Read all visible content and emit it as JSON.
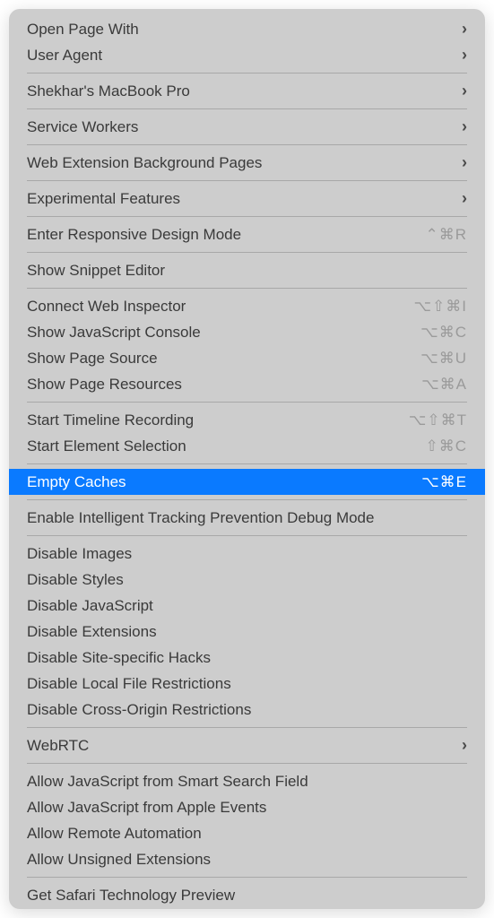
{
  "groups": [
    [
      {
        "id": "open-page-with",
        "label": "Open Page With",
        "submenu": true
      },
      {
        "id": "user-agent",
        "label": "User Agent",
        "submenu": true
      }
    ],
    [
      {
        "id": "device-name",
        "label": "Shekhar's MacBook Pro",
        "submenu": true
      }
    ],
    [
      {
        "id": "service-workers",
        "label": "Service Workers",
        "submenu": true
      }
    ],
    [
      {
        "id": "web-extension-bg-pages",
        "label": "Web Extension Background Pages",
        "submenu": true
      }
    ],
    [
      {
        "id": "experimental-features",
        "label": "Experimental Features",
        "submenu": true
      }
    ],
    [
      {
        "id": "enter-responsive-design",
        "label": "Enter Responsive Design Mode",
        "shortcut": "⌃⌘R"
      }
    ],
    [
      {
        "id": "show-snippet-editor",
        "label": "Show Snippet Editor"
      }
    ],
    [
      {
        "id": "connect-web-inspector",
        "label": "Connect Web Inspector",
        "shortcut": "⌥⇧⌘I"
      },
      {
        "id": "show-js-console",
        "label": "Show JavaScript Console",
        "shortcut": "⌥⌘C"
      },
      {
        "id": "show-page-source",
        "label": "Show Page Source",
        "shortcut": "⌥⌘U"
      },
      {
        "id": "show-page-resources",
        "label": "Show Page Resources",
        "shortcut": "⌥⌘A"
      }
    ],
    [
      {
        "id": "start-timeline-recording",
        "label": "Start Timeline Recording",
        "shortcut": "⌥⇧⌘T"
      },
      {
        "id": "start-element-selection",
        "label": "Start Element Selection",
        "shortcut": "⇧⌘C"
      }
    ],
    [
      {
        "id": "empty-caches",
        "label": "Empty Caches",
        "shortcut": "⌥⌘E",
        "highlighted": true
      }
    ],
    [
      {
        "id": "enable-itp-debug",
        "label": "Enable Intelligent Tracking Prevention Debug Mode"
      }
    ],
    [
      {
        "id": "disable-images",
        "label": "Disable Images"
      },
      {
        "id": "disable-styles",
        "label": "Disable Styles"
      },
      {
        "id": "disable-javascript",
        "label": "Disable JavaScript"
      },
      {
        "id": "disable-extensions",
        "label": "Disable Extensions"
      },
      {
        "id": "disable-site-hacks",
        "label": "Disable Site-specific Hacks"
      },
      {
        "id": "disable-local-file-restrictions",
        "label": "Disable Local File Restrictions"
      },
      {
        "id": "disable-cross-origin-restrictions",
        "label": "Disable Cross-Origin Restrictions"
      }
    ],
    [
      {
        "id": "webrtc",
        "label": "WebRTC",
        "submenu": true
      }
    ],
    [
      {
        "id": "allow-js-smart-search",
        "label": "Allow JavaScript from Smart Search Field"
      },
      {
        "id": "allow-js-apple-events",
        "label": "Allow JavaScript from Apple Events"
      },
      {
        "id": "allow-remote-automation",
        "label": "Allow Remote Automation"
      },
      {
        "id": "allow-unsigned-extensions",
        "label": "Allow Unsigned Extensions"
      }
    ],
    [
      {
        "id": "get-safari-tech-preview",
        "label": "Get Safari Technology Preview"
      }
    ]
  ]
}
